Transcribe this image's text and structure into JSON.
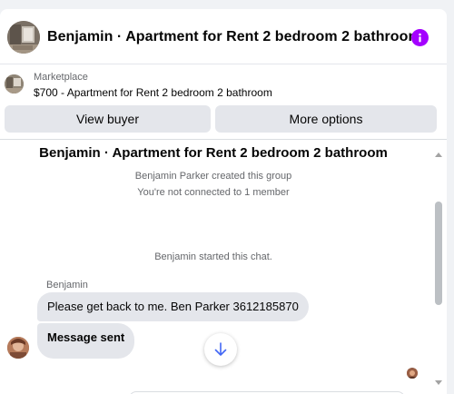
{
  "header": {
    "title": "Benjamin · Apartment for Rent 2 bedroom 2 bathroom",
    "info_icon": "info-icon",
    "accent_color": "#a400ff"
  },
  "marketplace": {
    "label": "Marketplace",
    "listing": "$700 - Apartment for Rent 2 bedroom 2 bathroom"
  },
  "actions": {
    "view_buyer": "View buyer",
    "more_options": "More options"
  },
  "chat": {
    "title": "Benjamin · Apartment for Rent 2 bedroom 2 bathroom",
    "created": "Benjamin Parker created this group",
    "not_connected": "You're not connected to 1 member",
    "started": "Benjamin started this chat.",
    "sender": "Benjamin",
    "messages": [
      {
        "text": "Please get back to me. Ben Parker 3612185870"
      },
      {
        "text": "Message sent"
      }
    ],
    "scroll_down_icon": "arrow-down-icon"
  }
}
